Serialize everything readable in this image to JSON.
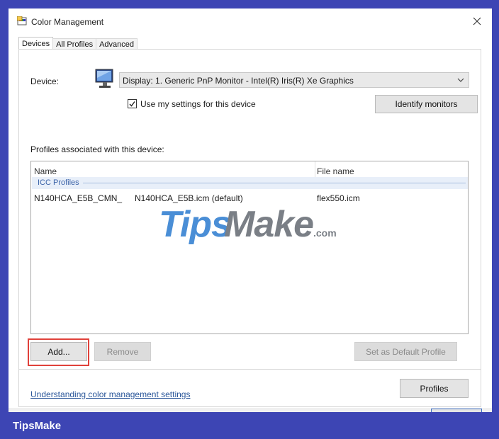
{
  "window": {
    "title": "Color Management"
  },
  "tabs": [
    {
      "label": "Devices",
      "active": true
    },
    {
      "label": "All Profiles",
      "active": false
    },
    {
      "label": "Advanced",
      "active": false
    }
  ],
  "device": {
    "label": "Device:",
    "selected": "Display: 1. Generic PnP Monitor - Intel(R) Iris(R) Xe Graphics",
    "use_settings_label": "Use my settings for this device",
    "use_settings_checked": true,
    "identify_label": "Identify monitors"
  },
  "profiles": {
    "section_label": "Profiles associated with this device:",
    "columns": {
      "name": "Name",
      "file": "File name"
    },
    "group": "ICC Profiles",
    "rows": [
      {
        "name_a": "N140HCA_E5B_CMN_",
        "name_b": "N140HCA_E5B.icm (default)",
        "file": "flex550.icm"
      }
    ]
  },
  "watermark": {
    "tips": "Tips",
    "make": "Make",
    "com": ".com"
  },
  "buttons": {
    "add": "Add...",
    "remove": "Remove",
    "set_default": "Set as Default Profile",
    "profiles": "Profiles"
  },
  "link": "Understanding color management settings",
  "brand": "TipsMake",
  "colors": {
    "background": "#3d45b4",
    "link": "#2b579a",
    "highlight": "#e0413a"
  }
}
